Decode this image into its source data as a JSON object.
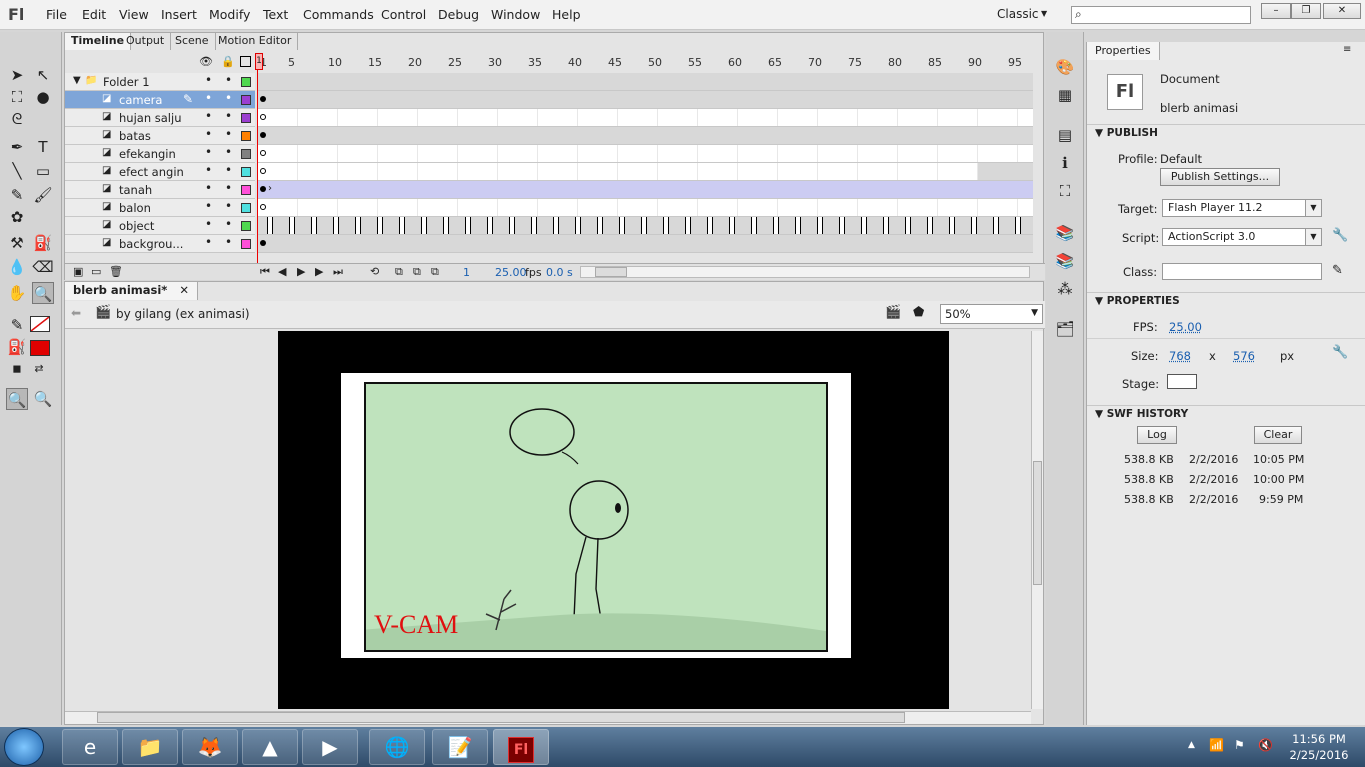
{
  "app": {
    "logo": "Fl"
  },
  "menu": [
    "File",
    "Edit",
    "View",
    "Insert",
    "Modify",
    "Text",
    "Commands",
    "Control",
    "Debug",
    "Window",
    "Help"
  ],
  "workspace": "Classic",
  "search": {
    "placeholder": ""
  },
  "window_buttons": {
    "minimize": "–",
    "restore": "❐",
    "close": "✕"
  },
  "timeline": {
    "tabs": [
      "Timeline",
      "Output",
      "Scene",
      "Motion Editor"
    ],
    "ruler": [
      "1",
      "5",
      "10",
      "15",
      "20",
      "25",
      "30",
      "35",
      "40",
      "45",
      "50",
      "55",
      "60",
      "65",
      "70",
      "75",
      "80",
      "85",
      "90",
      "95"
    ],
    "folder": "Folder 1",
    "layers": [
      "camera",
      "hujan salju",
      "batas",
      "efekangin",
      "efect angin",
      "tanah",
      "balon",
      "object",
      "backgrou..."
    ],
    "layer_colors": [
      "#9b3fd0",
      "#9b3fd0",
      "#ff8000",
      "#808080",
      "#4fe0e0",
      "#ff4fd8",
      "#4fe0e0",
      "#4fd84f",
      "#ff4fd8"
    ],
    "current_frame": "1",
    "fps": "25.00",
    "fps_unit": "fps",
    "elapsed": "0.0 s"
  },
  "document": {
    "tab": "blerb animasi*",
    "breadcrumb": "by gilang (ex animasi)",
    "zoom": "50%",
    "stage_text": "V-CAM"
  },
  "properties": {
    "tab": "Properties",
    "type": "Document",
    "name": "blerb animasi",
    "publish": {
      "header": "PUBLISH",
      "profile_label": "Profile:",
      "profile": "Default",
      "settings_button": "Publish Settings...",
      "target_label": "Target:",
      "target": "Flash Player 11.2",
      "script_label": "Script:",
      "script": "ActionScript 3.0",
      "class_label": "Class:"
    },
    "props": {
      "header": "PROPERTIES",
      "fps_label": "FPS:",
      "fps": "25.00",
      "size_label": "Size:",
      "width": "768",
      "x": "x",
      "height": "576",
      "unit": "px",
      "stage_label": "Stage:"
    },
    "history": {
      "header": "SWF HISTORY",
      "log": "Log",
      "clear": "Clear",
      "rows": [
        {
          "size": "538.8 KB",
          "date": "2/2/2016",
          "time": "10:05 PM"
        },
        {
          "size": "538.8 KB",
          "date": "2/2/2016",
          "time": "10:00 PM"
        },
        {
          "size": "538.8 KB",
          "date": "2/2/2016",
          "time": "9:59 PM"
        }
      ]
    }
  },
  "taskbar": {
    "time": "11:56 PM",
    "date": "2/25/2016"
  },
  "colors": {
    "stage_bg": "#bfe3bd",
    "stroke": "#e01010",
    "fill": "#e00000"
  }
}
